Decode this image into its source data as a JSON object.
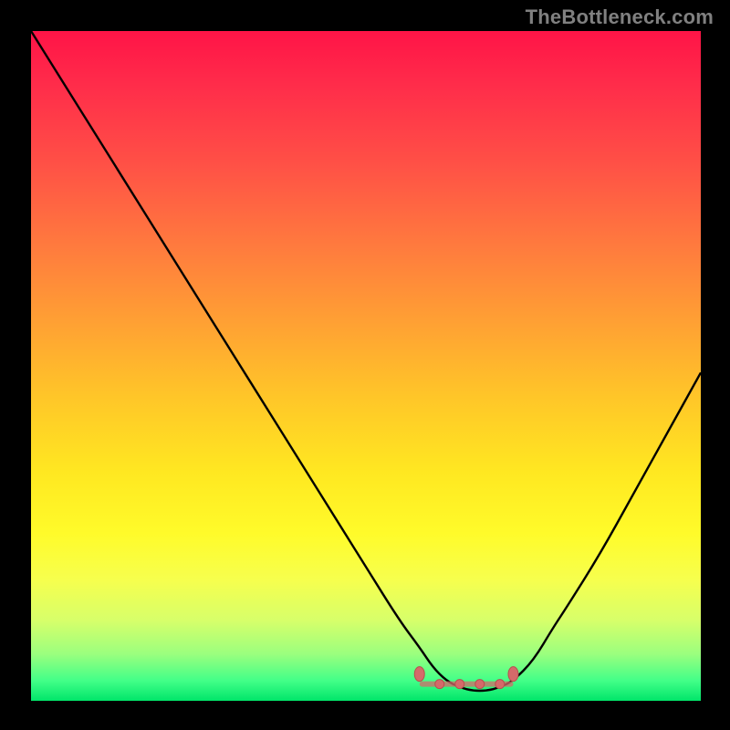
{
  "watermark": "TheBottleneck.com",
  "chart_data": {
    "type": "line",
    "title": "",
    "xlabel": "",
    "ylabel": "",
    "xlim": [
      0,
      100
    ],
    "ylim": [
      0,
      100
    ],
    "grid": false,
    "series": [
      {
        "name": "bottleneck-curve",
        "x": [
          0,
          5,
          10,
          15,
          20,
          25,
          30,
          35,
          40,
          45,
          50,
          55,
          58,
          60,
          62,
          64,
          66,
          68,
          70,
          72,
          75,
          78,
          80,
          85,
          90,
          95,
          100
        ],
        "y": [
          100,
          92,
          84,
          76,
          68,
          60,
          52,
          44,
          36,
          28,
          20,
          12,
          8,
          5,
          3,
          2,
          1.5,
          1.5,
          2,
          3,
          6,
          11,
          14,
          22,
          31,
          40,
          49
        ]
      }
    ],
    "markers": [
      {
        "name": "flat-region-start",
        "x": 58,
        "y": 4
      },
      {
        "name": "flat-region-end",
        "x": 72,
        "y": 4
      },
      {
        "name": "flat-region-mid-a",
        "x": 61,
        "y": 2.5
      },
      {
        "name": "flat-region-mid-b",
        "x": 64,
        "y": 2.5
      },
      {
        "name": "flat-region-mid-c",
        "x": 67,
        "y": 2.5
      },
      {
        "name": "flat-region-mid-d",
        "x": 70,
        "y": 2.5
      }
    ],
    "gradient_stops": [
      {
        "pos": 0,
        "color": "#ff1447"
      },
      {
        "pos": 8,
        "color": "#ff2c4a"
      },
      {
        "pos": 20,
        "color": "#ff5146"
      },
      {
        "pos": 32,
        "color": "#ff7a3e"
      },
      {
        "pos": 44,
        "color": "#ffa233"
      },
      {
        "pos": 55,
        "color": "#ffc728"
      },
      {
        "pos": 66,
        "color": "#ffe821"
      },
      {
        "pos": 75,
        "color": "#fffb2a"
      },
      {
        "pos": 82,
        "color": "#f6ff4e"
      },
      {
        "pos": 88,
        "color": "#d7ff6a"
      },
      {
        "pos": 93,
        "color": "#9bff7e"
      },
      {
        "pos": 97,
        "color": "#42ff88"
      },
      {
        "pos": 100,
        "color": "#00e56a"
      }
    ],
    "colors": {
      "curve": "#000000",
      "marker_fill": "#d46a6a",
      "marker_stroke": "#b94e4e",
      "background": "#000000"
    }
  }
}
